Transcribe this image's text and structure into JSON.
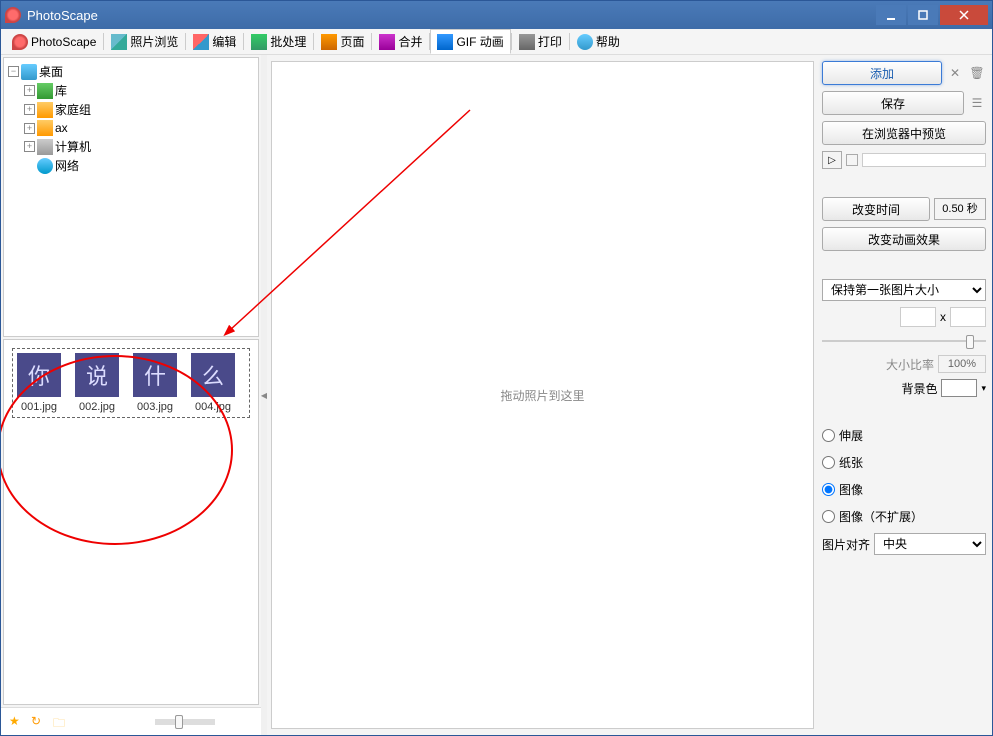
{
  "window": {
    "title": "PhotoScape"
  },
  "tabs": [
    {
      "label": "PhotoScape"
    },
    {
      "label": "照片浏览"
    },
    {
      "label": "编辑"
    },
    {
      "label": "批处理"
    },
    {
      "label": "页面"
    },
    {
      "label": "合并"
    },
    {
      "label": "GIF 动画"
    },
    {
      "label": "打印"
    },
    {
      "label": "帮助"
    }
  ],
  "tree": {
    "root": "桌面",
    "children": [
      {
        "label": "库"
      },
      {
        "label": "家庭组"
      },
      {
        "label": "ax"
      },
      {
        "label": "计算机"
      },
      {
        "label": "网络"
      }
    ]
  },
  "thumbs": [
    {
      "char": "你",
      "label": "001.jpg"
    },
    {
      "char": "说",
      "label": "002.jpg"
    },
    {
      "char": "什",
      "label": "003.jpg"
    },
    {
      "char": "么",
      "label": "004.jpg"
    }
  ],
  "preview": {
    "placeholder": "拖动照片到这里"
  },
  "right": {
    "add": "添加",
    "save": "保存",
    "previewBrowser": "在浏览器中预览",
    "changeTime": "改变时间",
    "timeValue": "0.50 秒",
    "changeEffect": "改变动画效果",
    "sizeMode": {
      "selected": "保持第一张图片大小"
    },
    "sizeX": "x",
    "ratioLabel": "大小比率",
    "ratioValue": "100%",
    "bgLabel": "背景色",
    "fitOptions": {
      "stretch": "伸展",
      "paper": "纸张",
      "image": "图像",
      "imageNoExpand": "图像（不扩展）"
    },
    "alignLabel": "图片对齐",
    "alignValue": "中央"
  }
}
